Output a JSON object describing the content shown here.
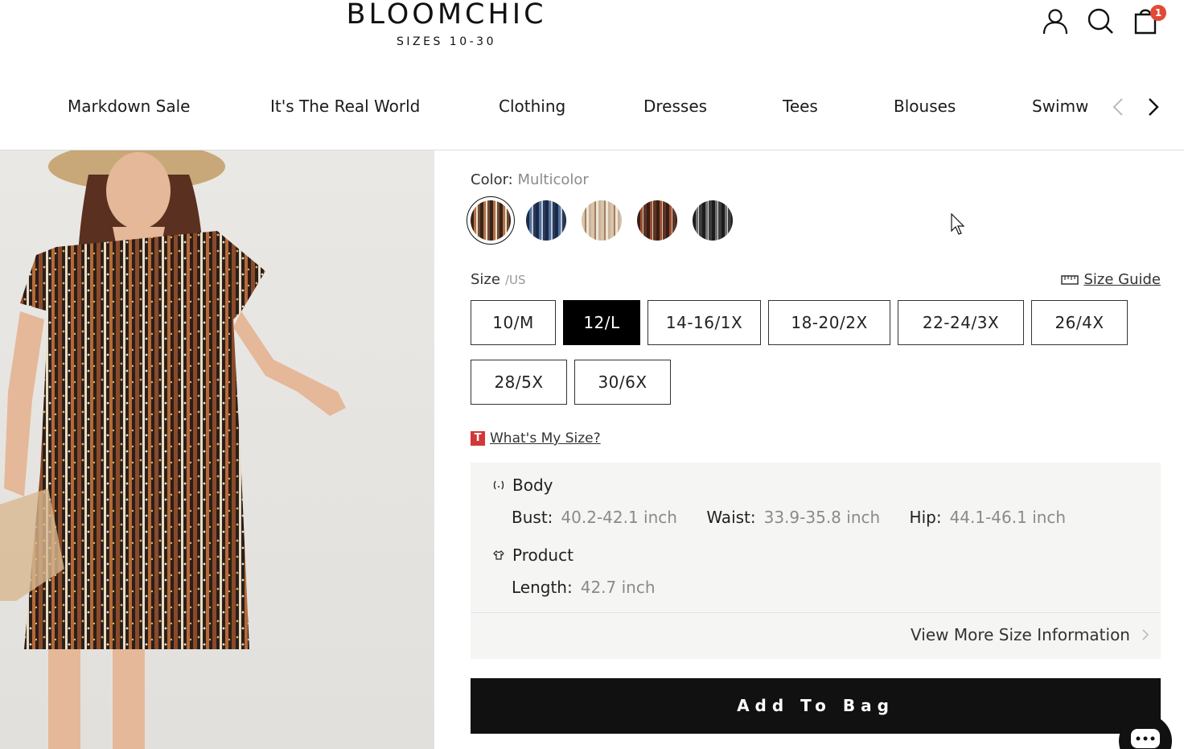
{
  "brand": {
    "name": "BLOOMCHIC",
    "tagline": "SIZES 10-30"
  },
  "header": {
    "cart_count": "1",
    "icons": [
      "account-icon",
      "search-icon",
      "cart-icon"
    ]
  },
  "nav": {
    "items": [
      "Markdown Sale",
      "It's The Real World",
      "Clothing",
      "Dresses",
      "Tees",
      "Blouses",
      "Swimw"
    ]
  },
  "product": {
    "color_label": "Color:",
    "color_value": "Multicolor",
    "swatch_colors": [
      "#6b4a38",
      "#3a4a66",
      "#c9b49c",
      "#5a3428",
      "#3c3c3c"
    ],
    "size_label": "Size",
    "size_unit": "/US",
    "size_guide": "Size Guide",
    "sizes": [
      "10/M",
      "12/L",
      "14-16/1X",
      "18-20/2X",
      "22-24/3X",
      "26/4X",
      "28/5X",
      "30/6X"
    ],
    "selected_size": "12/L",
    "whats_my_size_badge": "T",
    "whats_my_size": "What's My Size?"
  },
  "size_info": {
    "body_title": "Body",
    "bust_label": "Bust:",
    "bust_value": "40.2-42.1 inch",
    "waist_label": "Waist:",
    "waist_value": "33.9-35.8 inch",
    "hip_label": "Hip:",
    "hip_value": "44.1-46.1 inch",
    "product_title": "Product",
    "length_label": "Length:",
    "length_value": "42.7 inch",
    "view_more": "View More Size Information"
  },
  "cta": {
    "add_to_bag": "Add To Bag"
  }
}
